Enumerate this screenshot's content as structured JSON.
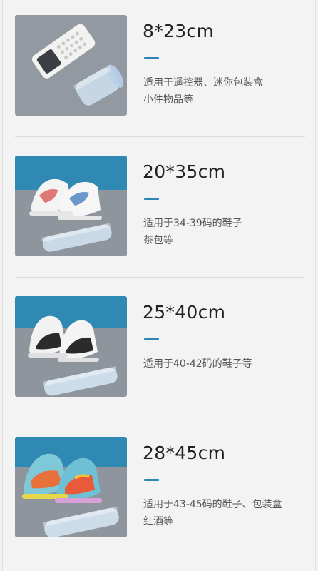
{
  "items": [
    {
      "size": "8*23cm",
      "lines": [
        "适用于遥控器、迷你包装盒",
        "小件物品等"
      ],
      "photo": "remote-control-with-shrink-film-roll"
    },
    {
      "size": "20*35cm",
      "lines": [
        "适用于34-39码的鞋子",
        "茶包等"
      ],
      "photo": "white-sneakers-with-shrink-film-roll"
    },
    {
      "size": "25*40cm",
      "lines": [
        "适用于40-42码的鞋子等"
      ],
      "photo": "black-white-sneakers-with-shrink-film-roll"
    },
    {
      "size": "28*45cm",
      "lines": [
        "适用于43-45码的鞋子、包装盒",
        "红酒等"
      ],
      "photo": "colorful-basketball-shoes-with-shrink-film-roll"
    }
  ],
  "colors": {
    "background": "#f3f3f3",
    "accent": "#2e86b8",
    "photo_backdrop": "#2f89b3",
    "photo_surface": "#8e959d"
  }
}
